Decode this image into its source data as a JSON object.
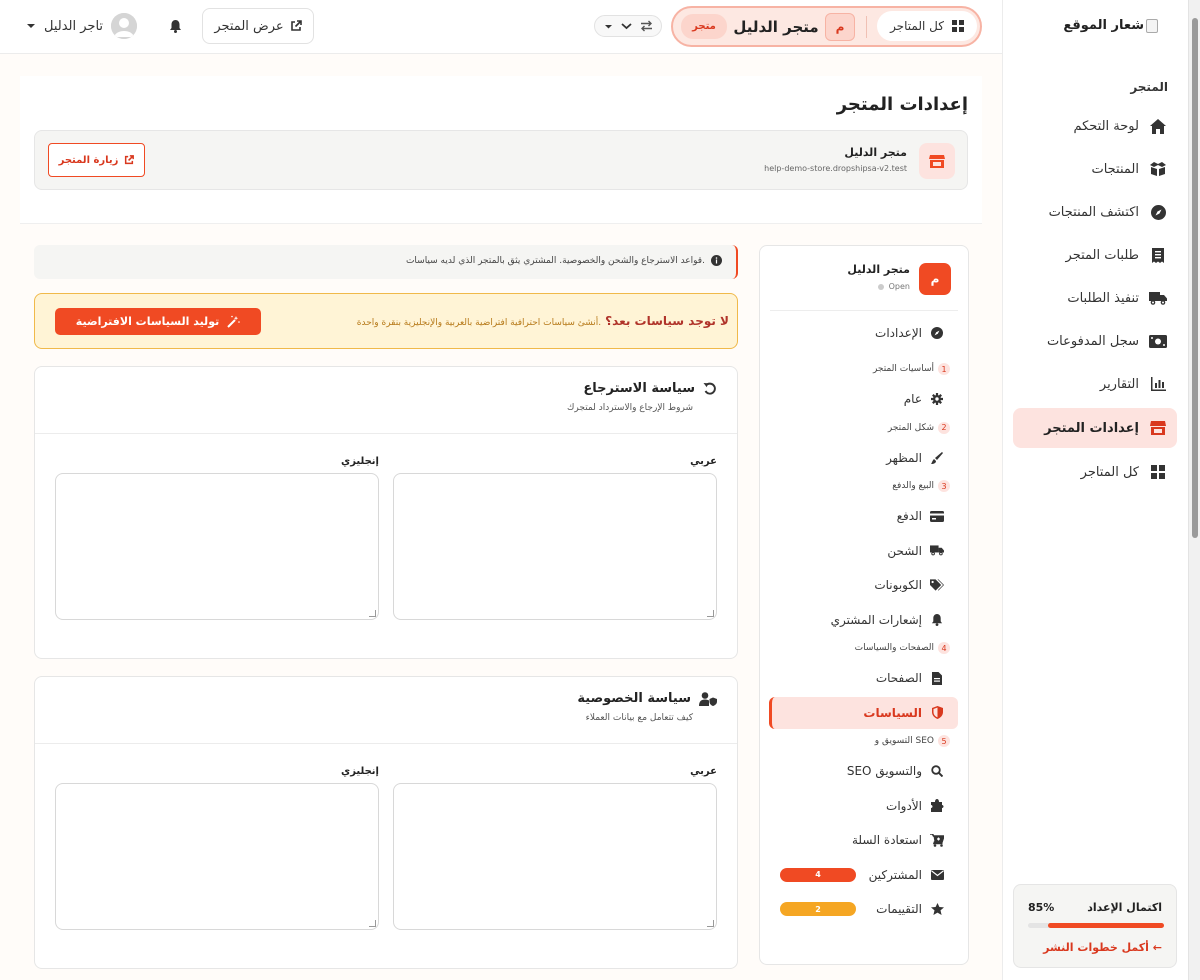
{
  "sidebar": {
    "logo_text": "شعار الموقع",
    "section_title": "المتجر",
    "items": [
      {
        "label": "لوحة التحكم",
        "icon": "home-icon"
      },
      {
        "label": "المنتجات",
        "icon": "box-icon"
      },
      {
        "label": "اكتشف المنتجات",
        "icon": "compass-icon"
      },
      {
        "label": "طلبات المتجر",
        "icon": "receipt-icon"
      },
      {
        "label": "تنفيذ الطلبات",
        "icon": "truck-icon"
      },
      {
        "label": "سجل المدفوعات",
        "icon": "money-icon"
      },
      {
        "label": "التقارير",
        "icon": "chart-icon"
      },
      {
        "label": "إعدادات المتجر",
        "icon": "store-icon",
        "active": true
      },
      {
        "label": "كل المتاجر",
        "icon": "grid-icon"
      }
    ],
    "progress": {
      "title": "اكتمال الإعداد",
      "percent_label": "85%",
      "value": 85,
      "link": "أكمل خطوات النشر ←"
    }
  },
  "topbar": {
    "all_stores": "كل المتاجر",
    "store_initial": "م",
    "store_name": "متجر الدليل",
    "store_tag": "متجر",
    "view_store": "عرض المتجر",
    "user_name": "تاجر الدليل"
  },
  "header": {
    "title": "إعدادات المتجر",
    "store_name": "متجر الدليل",
    "store_domain": "help-demo-store.dropshipsa-v2.test",
    "visit_button": "زيارة المتجر"
  },
  "settings_menu": {
    "store_initial": "م",
    "store_name": "متجر الدليل",
    "status": "Open",
    "settings_label": "الإعدادات",
    "steps": [
      {
        "num": "1",
        "title": "أساسيات المتجر",
        "items": [
          {
            "label": "عام",
            "icon": "gear-icon"
          }
        ]
      },
      {
        "num": "2",
        "title": "شكل المتجر",
        "items": [
          {
            "label": "المظهر",
            "icon": "brush-icon"
          }
        ]
      },
      {
        "num": "3",
        "title": "البيع والدفع",
        "items": [
          {
            "label": "الدفع",
            "icon": "card-icon"
          },
          {
            "label": "الشحن",
            "icon": "truck-icon"
          },
          {
            "label": "الكوبونات",
            "icon": "tags-icon"
          },
          {
            "label": "إشعارات المشتري",
            "icon": "bell-icon"
          }
        ]
      },
      {
        "num": "4",
        "title": "الصفحات والسياسات",
        "items": [
          {
            "label": "الصفحات",
            "icon": "file-icon"
          },
          {
            "label": "السياسات",
            "icon": "shield-icon",
            "active": true
          }
        ]
      },
      {
        "num": "5",
        "title": "التسويق و SEO",
        "items": [
          {
            "label": "SEO والتسويق",
            "icon": "search-icon"
          },
          {
            "label": "الأدوات",
            "icon": "puzzle-icon"
          },
          {
            "label": "استعادة السلة",
            "icon": "cart-icon"
          },
          {
            "label": "المشتركين",
            "icon": "envelope-icon",
            "badge": "4",
            "badge_color": "#f04a23"
          },
          {
            "label": "التقييمات",
            "icon": "star-icon",
            "badge": "2",
            "badge_color": "#f5a623"
          }
        ]
      }
    ]
  },
  "info_banner": "قواعد الاسترجاع والشحن والخصوصية. المشتري يثق بالمتجر الذي لديه سياسات.",
  "warning": {
    "title": "لا توجد سياسات بعد؟",
    "text": "أنشئ سياسات احترافية افتراضية بالعربية والإنجليزية بنقرة واحدة.",
    "button": "توليد السياسات الافتراضية"
  },
  "policies": [
    {
      "title": "سياسة الاسترجاع",
      "subtitle": "شروط الإرجاع والاسترداد لمتجرك",
      "arabic_label": "عربي",
      "english_label": "إنجليزي",
      "arabic_value": "",
      "english_value": "",
      "icon": "undo-icon"
    },
    {
      "title": "سياسة الخصوصية",
      "subtitle": "كيف تتعامل مع بيانات العملاء",
      "arabic_label": "عربي",
      "english_label": "إنجليزي",
      "arabic_value": "",
      "english_value": "",
      "icon": "user-shield-icon"
    }
  ],
  "colors": {
    "accent": "#f04a23",
    "accent_light": "#fde3df",
    "warning_bg": "#fff4d6",
    "warning_border": "#f0b94a",
    "badge_yellow": "#f5a623"
  }
}
